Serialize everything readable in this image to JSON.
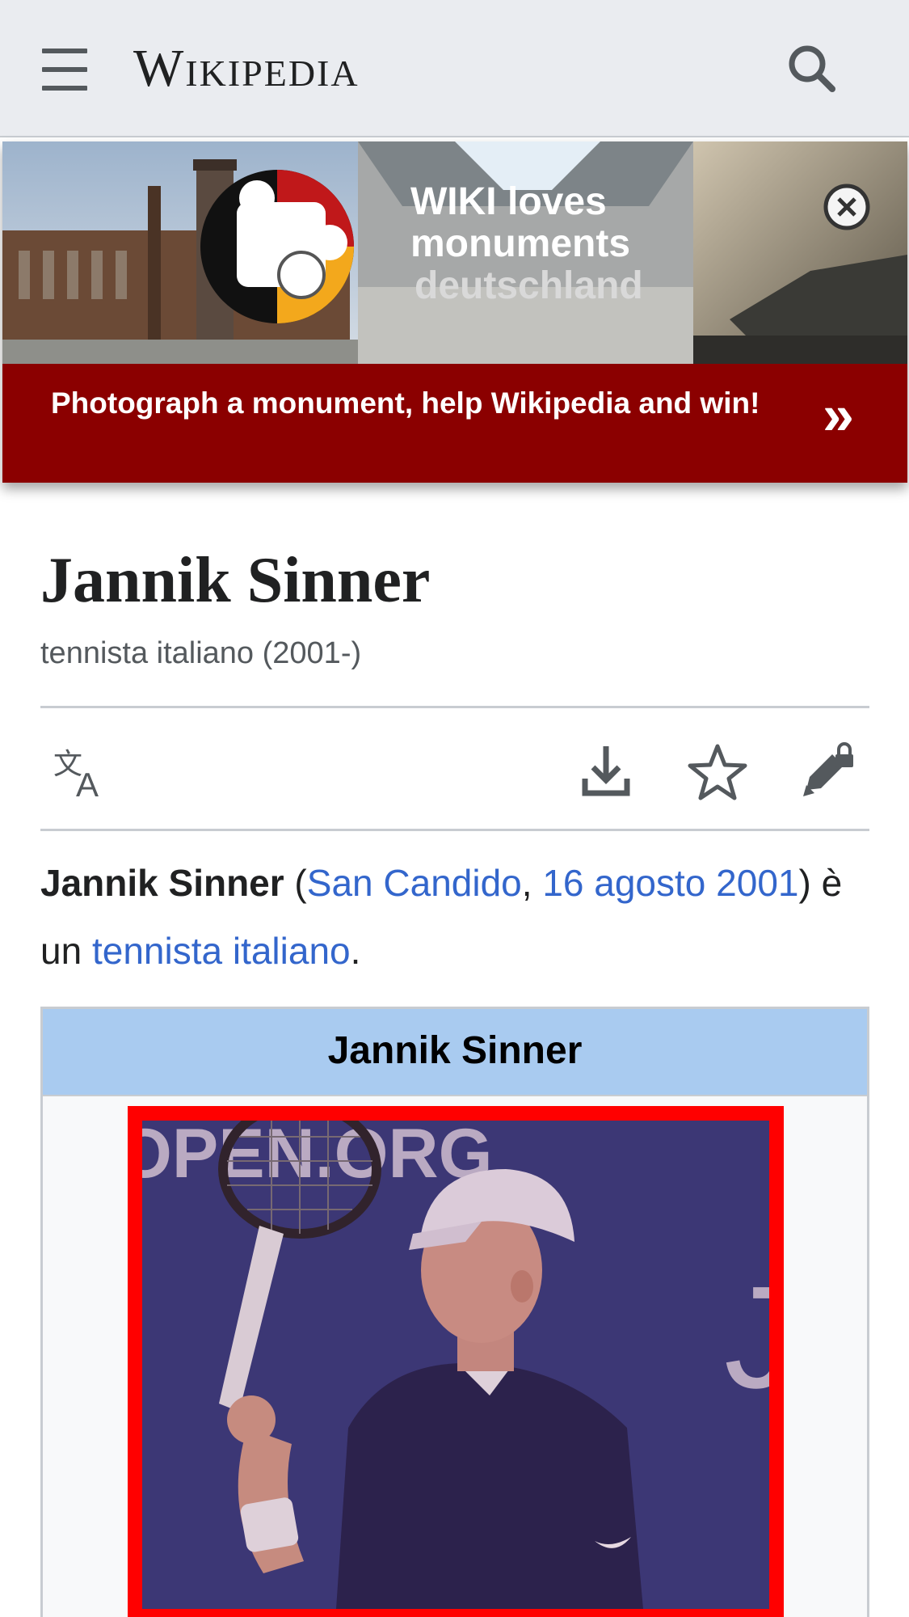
{
  "header": {
    "wordmark": "Wikipedia",
    "menu_icon": "hamburger-menu-icon",
    "search_icon": "search-icon"
  },
  "banner": {
    "image_text": [
      "WIKI loves",
      "monuments",
      "deutschland"
    ],
    "cta_text": "Photograph a monument, help Wikipedia and win!",
    "arrow": "»",
    "close_icon": "close-circle-icon",
    "background_color": "#8b0000"
  },
  "article": {
    "title": "Jannik Sinner",
    "subtitle": "tennista italiano (2001-)",
    "actions": [
      {
        "name": "language",
        "icon": "translate-icon"
      },
      {
        "name": "download",
        "icon": "download-icon"
      },
      {
        "name": "watch",
        "icon": "star-icon"
      },
      {
        "name": "edit",
        "icon": "edit-lock-icon"
      }
    ],
    "lead": {
      "bold_name": "Jannik Sinner",
      "open_paren": " (",
      "link_birthplace": "San Candido",
      "comma": ", ",
      "link_birthdate": "16 agosto 2001",
      "middle": ") è un ",
      "link_profession": "tennista italiano",
      "end": "."
    }
  },
  "infobox": {
    "title": "Jannik Sinner",
    "header_color": "#a9cbf0",
    "image_border_color": "#ff0000",
    "image_backdrop_text": "OPEN.ORG"
  },
  "colors": {
    "link": "#3366cc",
    "header_bg": "#eaecf0"
  }
}
